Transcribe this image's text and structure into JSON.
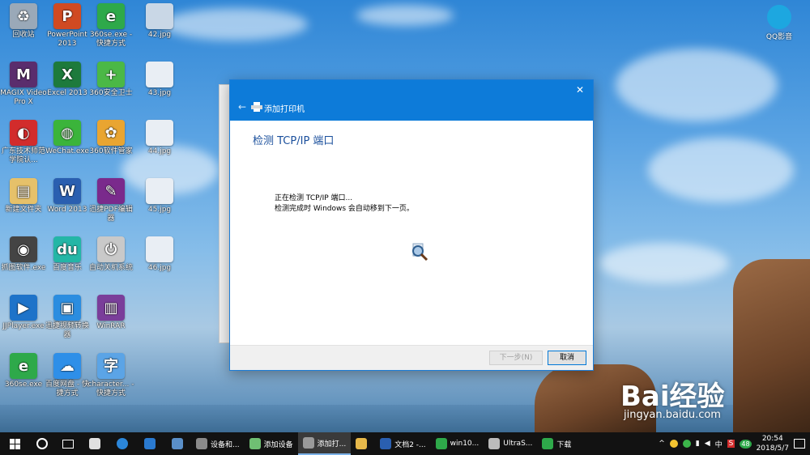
{
  "desktop_icons": [
    {
      "label": "回收站",
      "color": "#9aa9b8",
      "glyph": "♻"
    },
    {
      "label": "PowerPoint 2013",
      "color": "#d04a22",
      "glyph": "P"
    },
    {
      "label": "360se.exe - 快捷方式",
      "color": "#2ea94a",
      "glyph": "e"
    },
    {
      "label": "42.jpg",
      "color": "#c9d7e6",
      "glyph": ""
    },
    {
      "label": "MAGIX Video Pro X",
      "color": "#5a2d6d",
      "glyph": "M"
    },
    {
      "label": "Excel 2013",
      "color": "#1d7a3c",
      "glyph": "X"
    },
    {
      "label": "360安全卫士",
      "color": "#4bb846",
      "glyph": "+"
    },
    {
      "label": "43.jpg",
      "color": "#e9eef4",
      "glyph": ""
    },
    {
      "label": "广东技术师范学院认...",
      "color": "#d22c2c",
      "glyph": "◐"
    },
    {
      "label": "WeChat.exe",
      "color": "#3bb43b",
      "glyph": "◍"
    },
    {
      "label": "360软件管家",
      "color": "#e9a531",
      "glyph": "✿"
    },
    {
      "label": "44.jpg",
      "color": "#e9eef4",
      "glyph": ""
    },
    {
      "label": "新建文件夹",
      "color": "#e6c16a",
      "glyph": "▤"
    },
    {
      "label": "Word 2013",
      "color": "#2a5fb0",
      "glyph": "W"
    },
    {
      "label": "迅捷PDF编辑器",
      "color": "#7a2a8c",
      "glyph": "✎"
    },
    {
      "label": "45.jpg",
      "color": "#e9eef4",
      "glyph": ""
    },
    {
      "label": "抓图软件.exe",
      "color": "#444444",
      "glyph": "◉"
    },
    {
      "label": "百度音乐",
      "color": "#24b6a6",
      "glyph": "du"
    },
    {
      "label": "自动关机系统",
      "color": "#c9c9c9",
      "glyph": "⏻"
    },
    {
      "label": "46.jpg",
      "color": "#e9eef4",
      "glyph": ""
    },
    {
      "label": "JJPlayer.exe",
      "color": "#1e73c9",
      "glyph": "▶"
    },
    {
      "label": "迅捷视频转换器",
      "color": "#2b8de0",
      "glyph": "▣"
    },
    {
      "label": "WinRAR",
      "color": "#7a3e9a",
      "glyph": "▥"
    },
    {
      "label": "360se.exe",
      "color": "#2ea94a",
      "glyph": "e"
    },
    {
      "label": "百度网盘 - 快捷方式",
      "color": "#2e8fe8",
      "glyph": "☁"
    },
    {
      "label": "character... - 快捷方式",
      "color": "#5ba4e6",
      "glyph": "字"
    }
  ],
  "qq_icon": {
    "label": "QQ影音",
    "color": "#1da7e0"
  },
  "dialog": {
    "title": "添加打印机",
    "close_glyph": "✕",
    "back_glyph": "←",
    "heading": "检测 TCP/IP 端口",
    "message_line1": "正在检测 TCP/IP 端口...",
    "message_line2": "检测完成时 Windows 会自动移到下一页。",
    "next_label": "下一步(N)",
    "cancel_label": "取消"
  },
  "taskbar": {
    "items": [
      {
        "label": "设备和...",
        "color": "#8a8a8a",
        "active": false
      },
      {
        "label": "添加设备",
        "color": "#6fbf73",
        "active": false
      },
      {
        "label": "添加打...",
        "color": "#9a9a9a",
        "active": true
      },
      {
        "label": "",
        "color": "#e6b84a",
        "active": false
      },
      {
        "label": "文档2 -...",
        "color": "#2a5fb0",
        "active": false
      },
      {
        "label": "win10...",
        "color": "#2ea94a",
        "active": false
      },
      {
        "label": "UltraS...",
        "color": "#bbbbbb",
        "active": false
      },
      {
        "label": "下载",
        "color": "#2ea94a",
        "active": false
      }
    ],
    "tray": {
      "ime": "中",
      "badge": "48",
      "time": "20:54",
      "date": "2018/5/7"
    }
  },
  "watermark": {
    "brand": "Bai经验",
    "url": "jingyan.baidu.com"
  }
}
